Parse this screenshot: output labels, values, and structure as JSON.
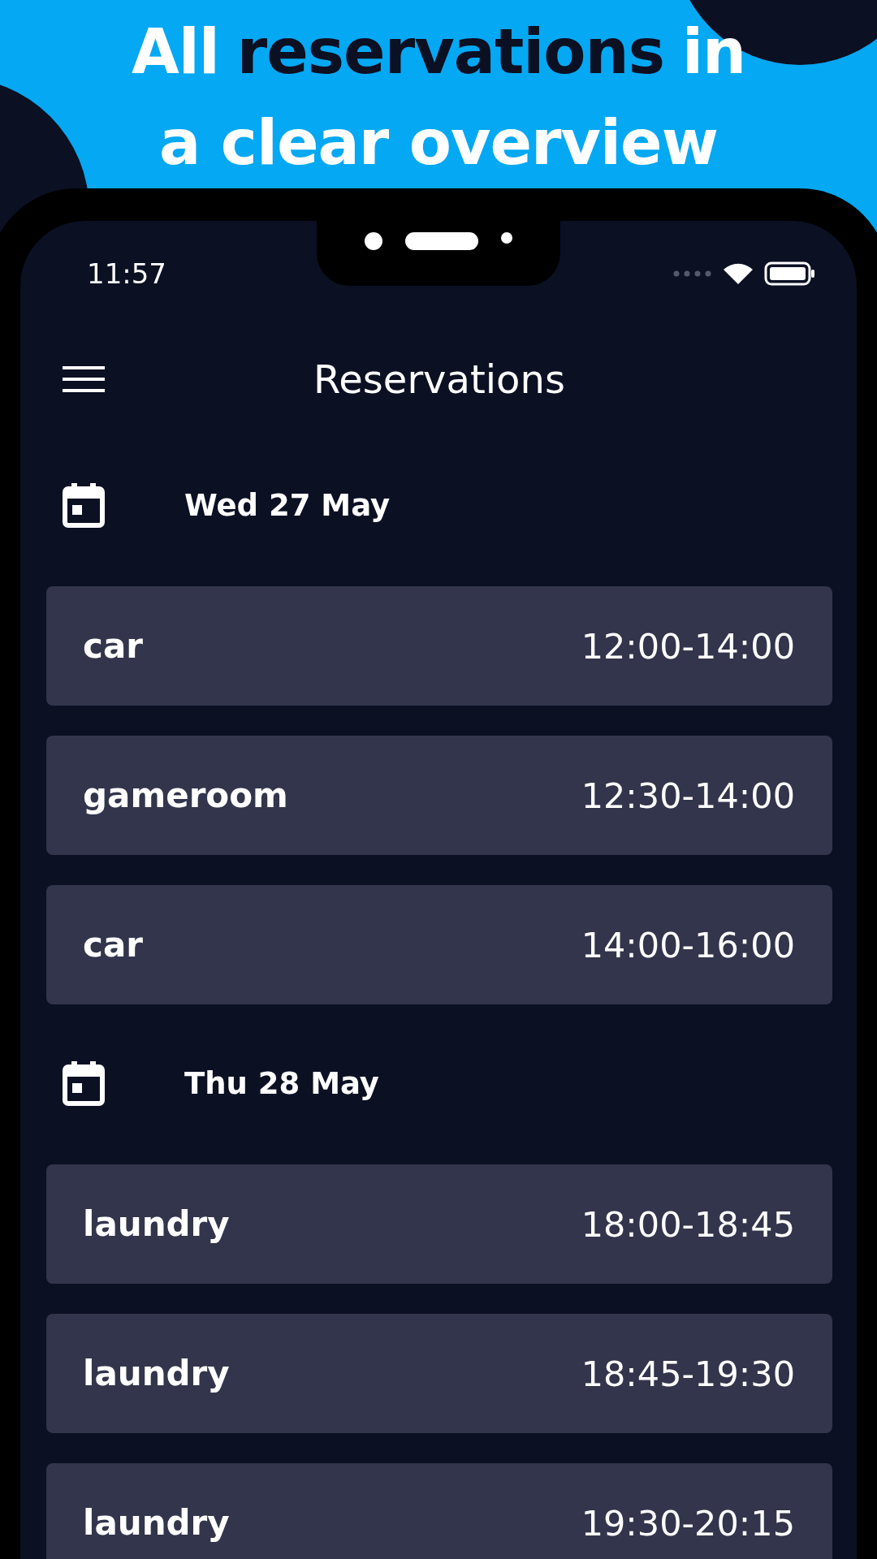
{
  "headline": {
    "lines": [
      [
        {
          "text": "All",
          "highlighted": false
        },
        {
          "text": "reservations",
          "highlighted": true
        },
        {
          "text": "in",
          "highlighted": false
        }
      ],
      [
        {
          "text": "a clear overview",
          "highlighted": false
        }
      ]
    ]
  },
  "status_bar": {
    "time": "11:57"
  },
  "app_bar": {
    "title": "Reservations"
  },
  "days": [
    {
      "date": "Wed 27 May",
      "reservations": [
        {
          "name": "car",
          "time": "12:00-14:00"
        },
        {
          "name": "gameroom",
          "time": "12:30-14:00"
        },
        {
          "name": "car",
          "time": "14:00-16:00"
        }
      ]
    },
    {
      "date": "Thu 28 May",
      "reservations": [
        {
          "name": "laundry",
          "time": "18:00-18:45"
        },
        {
          "name": "laundry",
          "time": "18:45-19:30"
        },
        {
          "name": "laundry",
          "time": "19:30-20:15"
        }
      ]
    }
  ]
}
